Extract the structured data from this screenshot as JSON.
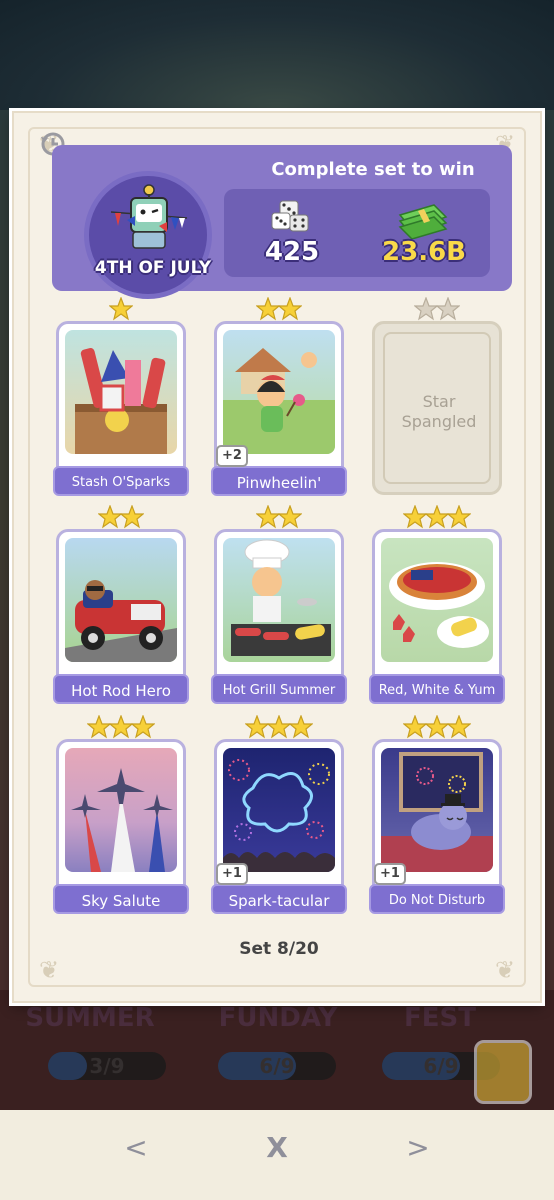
{
  "set": {
    "name": "4TH OF JULY",
    "complete_text": "Complete set to win",
    "rewards": {
      "dice": "425",
      "cash": "23.6B"
    },
    "progress_text": "Set 8/20"
  },
  "cards": [
    {
      "name": "Stash O'Sparks",
      "stars": 1,
      "owned": true,
      "extra": ""
    },
    {
      "name": "Pinwheelin'",
      "stars": 2,
      "owned": true,
      "extra": "+2"
    },
    {
      "name": "Star Spangled",
      "stars": 2,
      "owned": false,
      "extra": ""
    },
    {
      "name": "Hot Rod Hero",
      "stars": 2,
      "owned": true,
      "extra": ""
    },
    {
      "name": "Hot Grill Summer",
      "stars": 2,
      "owned": true,
      "extra": ""
    },
    {
      "name": "Red, White & Yum",
      "stars": 3,
      "owned": true,
      "extra": ""
    },
    {
      "name": "Sky Salute",
      "stars": 3,
      "owned": true,
      "extra": ""
    },
    {
      "name": "Spark-tacular",
      "stars": 3,
      "owned": true,
      "extra": "+1"
    },
    {
      "name": "Do Not Disturb",
      "stars": 3,
      "owned": true,
      "extra": "+1"
    }
  ],
  "background_sets": [
    {
      "name": "SUMMER",
      "progress": "3/9",
      "fill_fraction": 0.33
    },
    {
      "name": "FUNDAY",
      "progress": "6/9",
      "fill_fraction": 0.66
    },
    {
      "name": "FEST",
      "progress": "6/9",
      "fill_fraction": 0.66
    }
  ],
  "nav": {
    "prev": "<",
    "close": "X",
    "next": ">"
  },
  "colors": {
    "accent": "#8878c8",
    "label": "#7e6fd0",
    "star": "#f7d038"
  }
}
